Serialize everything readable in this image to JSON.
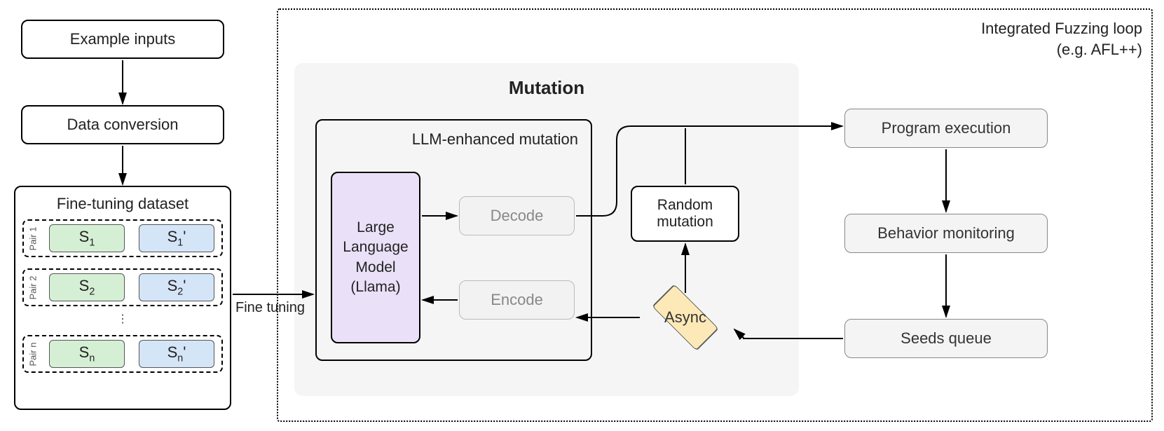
{
  "left": {
    "example_inputs": "Example inputs",
    "data_conversion": "Data conversion",
    "finetune_title": "Fine-tuning dataset",
    "pair1": "Pair 1",
    "pair2": "Pair 2",
    "pairn": "Pair n",
    "s1": "S",
    "s1_sub": "1",
    "s1p": "S",
    "s1p_sub": "1",
    "prime": "'",
    "s2": "S",
    "s2_sub": "2",
    "s2p": "S",
    "s2p_sub": "2",
    "sn": "S",
    "sn_sub": "n",
    "snp": "S",
    "snp_sub": "n",
    "dots": "⋮"
  },
  "edges": {
    "fine_tuning": "Fine tuning"
  },
  "right": {
    "loop_title1": "Integrated Fuzzing loop",
    "loop_title2": "(e.g. AFL++)",
    "mutation_title": "Mutation",
    "llm_group_title": "LLM-enhanced mutation",
    "llm_box": "Large Language Model (Llama)",
    "decode": "Decode",
    "encode": "Encode",
    "random_mutation": "Random mutation",
    "async": "Async",
    "program_exec": "Program execution",
    "behavior_mon": "Behavior monitoring",
    "seeds_queue": "Seeds queue"
  }
}
